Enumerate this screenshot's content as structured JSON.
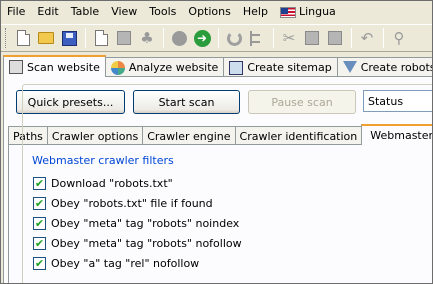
{
  "menu": {
    "items": [
      "File",
      "Edit",
      "Table",
      "View",
      "Tools",
      "Options",
      "Help"
    ],
    "lingua_label": "Lingua"
  },
  "toolbar": {
    "icons": [
      "new-document-icon",
      "open-folder-icon",
      "save-icon",
      "copy-icon",
      "paste-icon",
      "clear-icon",
      "stop-icon",
      "start-icon",
      "refresh-icon",
      "tree-icon",
      "cut-icon",
      "copy2-icon",
      "paste2-icon",
      "undo-icon",
      "search-icon"
    ]
  },
  "main_tabs": [
    {
      "label": "Scan website",
      "active": true
    },
    {
      "label": "Analyze website",
      "active": false
    },
    {
      "label": "Create sitemap",
      "active": false
    },
    {
      "label": "Create robots.txt",
      "active": false
    }
  ],
  "buttons": {
    "quick_presets": "Quick presets...",
    "start_scan": "Start scan",
    "pause_scan": "Pause scan"
  },
  "status_combo": "Status",
  "sub_tabs": [
    {
      "label": "Paths",
      "active": false
    },
    {
      "label": "Crawler options",
      "active": false
    },
    {
      "label": "Crawler engine",
      "active": false
    },
    {
      "label": "Crawler identification",
      "active": false
    },
    {
      "label": "Webmaster filters",
      "active": true
    }
  ],
  "group": {
    "title": "Webmaster crawler filters",
    "options": [
      {
        "label": "Download \"robots.txt\"",
        "checked": true
      },
      {
        "label": "Obey \"robots.txt\" file if found",
        "checked": true
      },
      {
        "label": "Obey \"meta\" tag \"robots\" noindex",
        "checked": true
      },
      {
        "label": "Obey \"meta\" tag \"robots\" nofollow",
        "checked": true
      },
      {
        "label": "Obey \"a\" tag \"rel\" nofollow",
        "checked": true
      }
    ]
  }
}
